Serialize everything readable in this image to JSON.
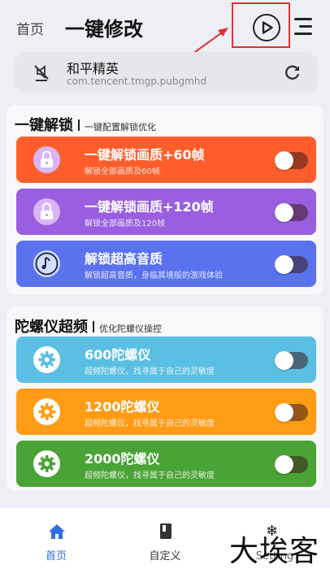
{
  "header": {
    "tab_home": "首页",
    "title": "一键修改",
    "play_icon": "play-circle-icon",
    "menu_icon": "menu-icon"
  },
  "app": {
    "name": "和平精英",
    "package": "com.tencent.tmgp.pubgmhd",
    "icon": "mute-icon",
    "refresh_icon": "refresh-icon"
  },
  "section_unlock": {
    "title": "一键解锁",
    "desc": "一键配置解锁优化",
    "items": [
      {
        "label": "一键解锁画质+60帧",
        "sub": "解锁全部画质及60帧",
        "color": "#ff5e2c",
        "icon": "lock-icon",
        "enabled": false
      },
      {
        "label": "一键解锁画质+120帧",
        "sub": "解锁全部画质及120帧",
        "color": "#9a5ee0",
        "icon": "lock-icon",
        "enabled": false
      },
      {
        "label": "解锁超高音质",
        "sub": "解锁超高音质，身临其境般的游戏体验",
        "color": "#5a72ee",
        "icon": "music-note-icon",
        "enabled": false
      }
    ]
  },
  "section_gyro": {
    "title": "陀螺仪超频",
    "desc": "优化陀螺仪操控",
    "items": [
      {
        "label": "600陀螺仪",
        "sub": "超频陀螺仪，找寻属于自己的灵敏度",
        "color": "#5bbfe3",
        "icon": "gear-icon",
        "enabled": false
      },
      {
        "label": "1200陀螺仪",
        "sub": "超频陀螺仪，找寻属于自己的灵敏度",
        "color": "#ff9b14",
        "icon": "gear-icon",
        "enabled": false
      },
      {
        "label": "2000陀螺仪",
        "sub": "超频陀螺仪，找寻属于自己的灵敏度",
        "color": "#4aa336",
        "icon": "gear-icon",
        "enabled": false
      }
    ]
  },
  "bottom_nav": {
    "home_label": "首页",
    "custom_label": "自定义",
    "setting_label": "Setting",
    "home_icon": "home-icon",
    "custom_icon": "book-icon"
  },
  "watermark": "大埃客",
  "colors": {
    "accent": "#2f6fe0",
    "highlight": "#e23030"
  }
}
